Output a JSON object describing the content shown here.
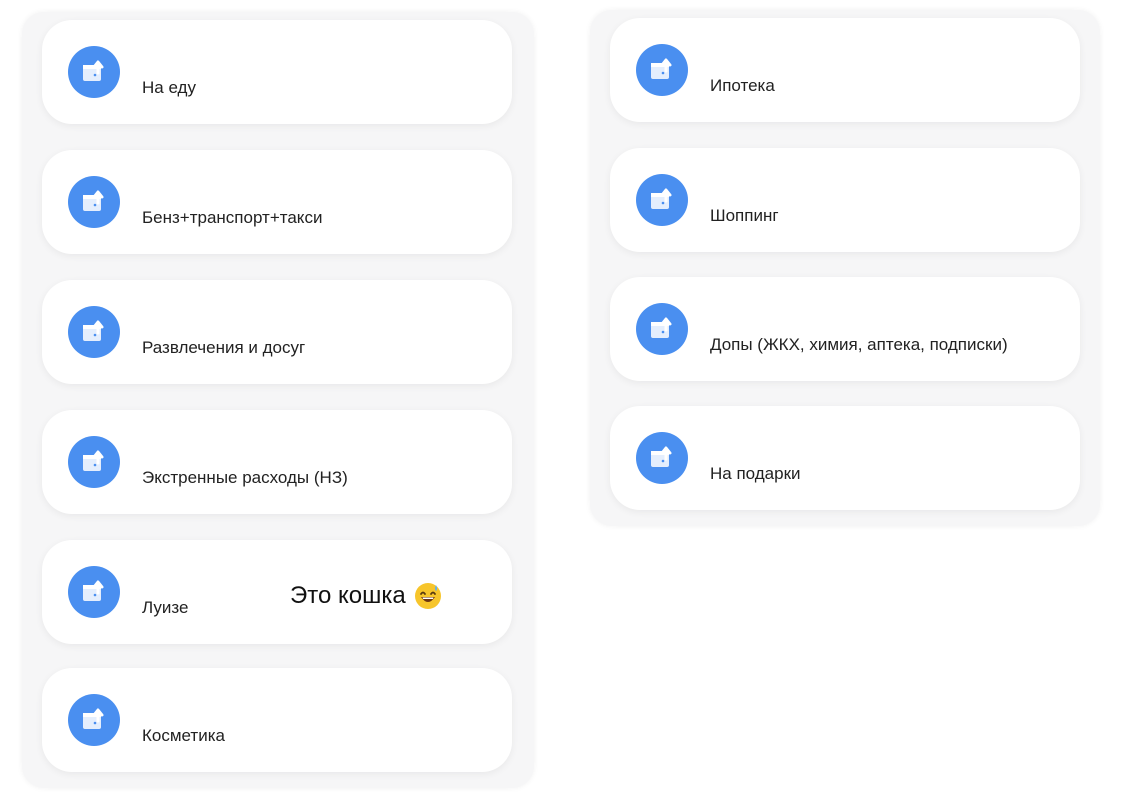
{
  "left_column": {
    "items": [
      {
        "label": "На еду"
      },
      {
        "label": "Бенз+транспорт+такси"
      },
      {
        "label": "Развлечения и досуг"
      },
      {
        "label": "Экстренные расходы (НЗ)"
      },
      {
        "label": "Луизе",
        "note": "Это кошка"
      },
      {
        "label": "Косметика"
      }
    ]
  },
  "right_column": {
    "items": [
      {
        "label": "Ипотека"
      },
      {
        "label": "Шоппинг"
      },
      {
        "label": "Допы (ЖКХ, химия, аптека, подписки)"
      },
      {
        "label": "На подарки"
      }
    ]
  },
  "colors": {
    "badge": "#4a8ff0",
    "panel": "#f6f6f7",
    "card": "#ffffff"
  },
  "icons": {
    "badge_icon": "wallet-arrow-up-icon",
    "note_emoji": "grinning-sweat-emoji-icon"
  }
}
